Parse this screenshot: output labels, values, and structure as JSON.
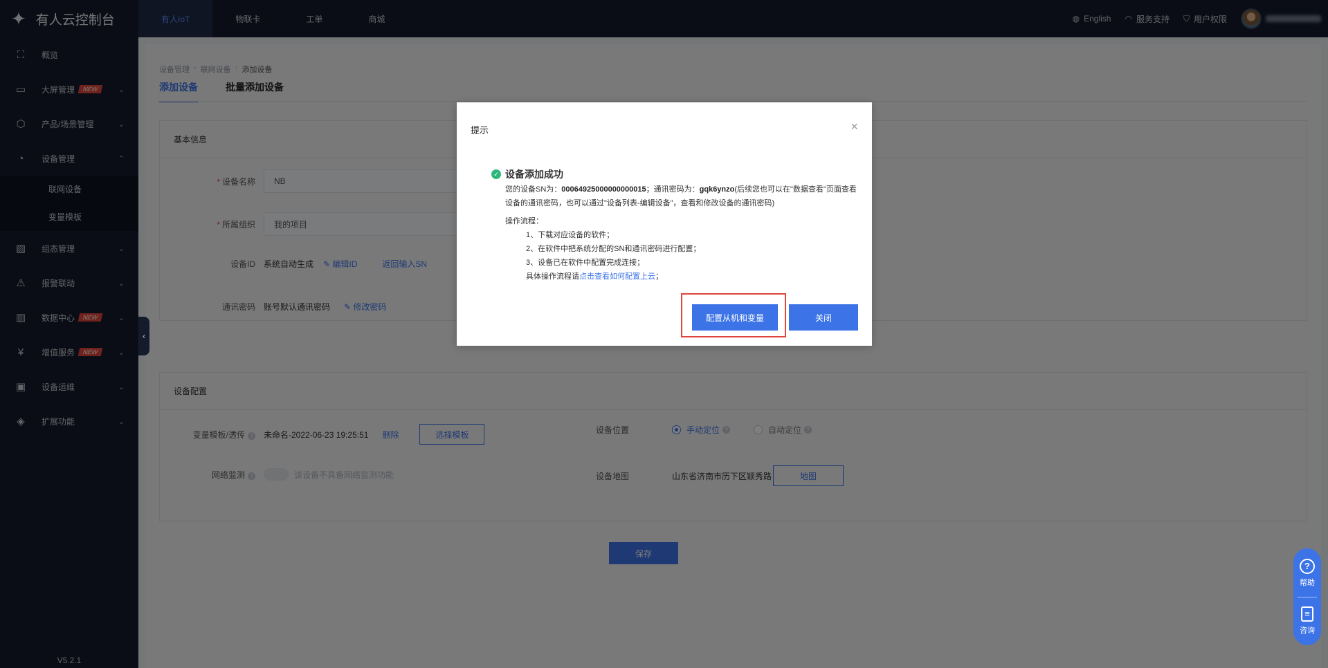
{
  "app": {
    "title": "有人云控制台",
    "version": "V5.2.1"
  },
  "topbar": {
    "tabs": [
      "有人IoT",
      "物联卡",
      "工单",
      "商城"
    ],
    "english": "English",
    "support": "服务支持",
    "permissions": "用户权限"
  },
  "sidebar": {
    "items": [
      {
        "label": "概览",
        "icon": "overview-icon"
      },
      {
        "label": "大屏管理",
        "icon": "screen-icon",
        "badge": "NEW"
      },
      {
        "label": "产品/场景管理",
        "icon": "cube-icon"
      },
      {
        "label": "设备管理",
        "icon": "pie-icon"
      },
      {
        "label": "组态管理",
        "icon": "image-icon"
      },
      {
        "label": "报警联动",
        "icon": "alert-icon"
      },
      {
        "label": "数据中心",
        "icon": "chart-icon",
        "badge": "NEW"
      },
      {
        "label": "增值服务",
        "icon": "yen-icon",
        "badge": "NEW"
      },
      {
        "label": "设备运维",
        "icon": "monitor-icon"
      },
      {
        "label": "扩展功能",
        "icon": "layers-icon"
      }
    ],
    "sub_items": [
      "联网设备",
      "变量模板"
    ]
  },
  "breadcrumb": [
    "设备管理",
    "联网设备",
    "添加设备"
  ],
  "page_tabs": [
    "添加设备",
    "批量添加设备"
  ],
  "basic": {
    "title": "基本信息",
    "device_name_label": "设备名称",
    "device_name_value": "NB",
    "org_label": "所属组织",
    "org_value": "我的项目",
    "device_id_label": "设备ID",
    "device_id_value": "系统自动生成",
    "edit_id": "编辑ID",
    "back_sn": "返回输入SN",
    "pwd_label": "通讯密码",
    "pwd_value": "账号默认通讯密码",
    "edit_pwd": "修改密码"
  },
  "config": {
    "title": "设备配置",
    "template_label": "变量模板/透传",
    "template_value": "未命名-2022-06-23 19:25:51",
    "delete": "删除",
    "choose_template": "选择模板",
    "location_label": "设备位置",
    "manual": "手动定位",
    "auto": "自动定位",
    "network_label": "网络监测",
    "network_hint": "该设备不具备网络监测功能",
    "map_label": "设备地图",
    "map_value": "山东省济南市历下区颖秀路",
    "map_button": "地图"
  },
  "save": "保存",
  "float_help": {
    "help": "帮助",
    "consult": "咨询"
  },
  "modal": {
    "title": "提示",
    "success": "设备添加成功",
    "sn_prefix": "您的设备SN为：",
    "sn": "00064925000000000015",
    "pwd_prefix": "；通讯密码为：",
    "pwd": "gqk6ynzo",
    "note": "(后续您也可以在\"数据查看\"页面查看设备的通讯密码，也可以通过\"设备列表-编辑设备\"，查看和修改设备的通讯密码)",
    "process_title": "操作流程：",
    "steps": [
      "1、下载对应设备的软件；",
      "2、在软件中把系统分配的SN和通讯密码进行配置；",
      "3、设备已在软件中配置完成连接；"
    ],
    "detail_prefix": "具体操作流程请",
    "detail_link": "点击查看如何配置上云",
    "detail_suffix": "；",
    "config_button": "配置从机和变量",
    "close_button": "关闭"
  }
}
